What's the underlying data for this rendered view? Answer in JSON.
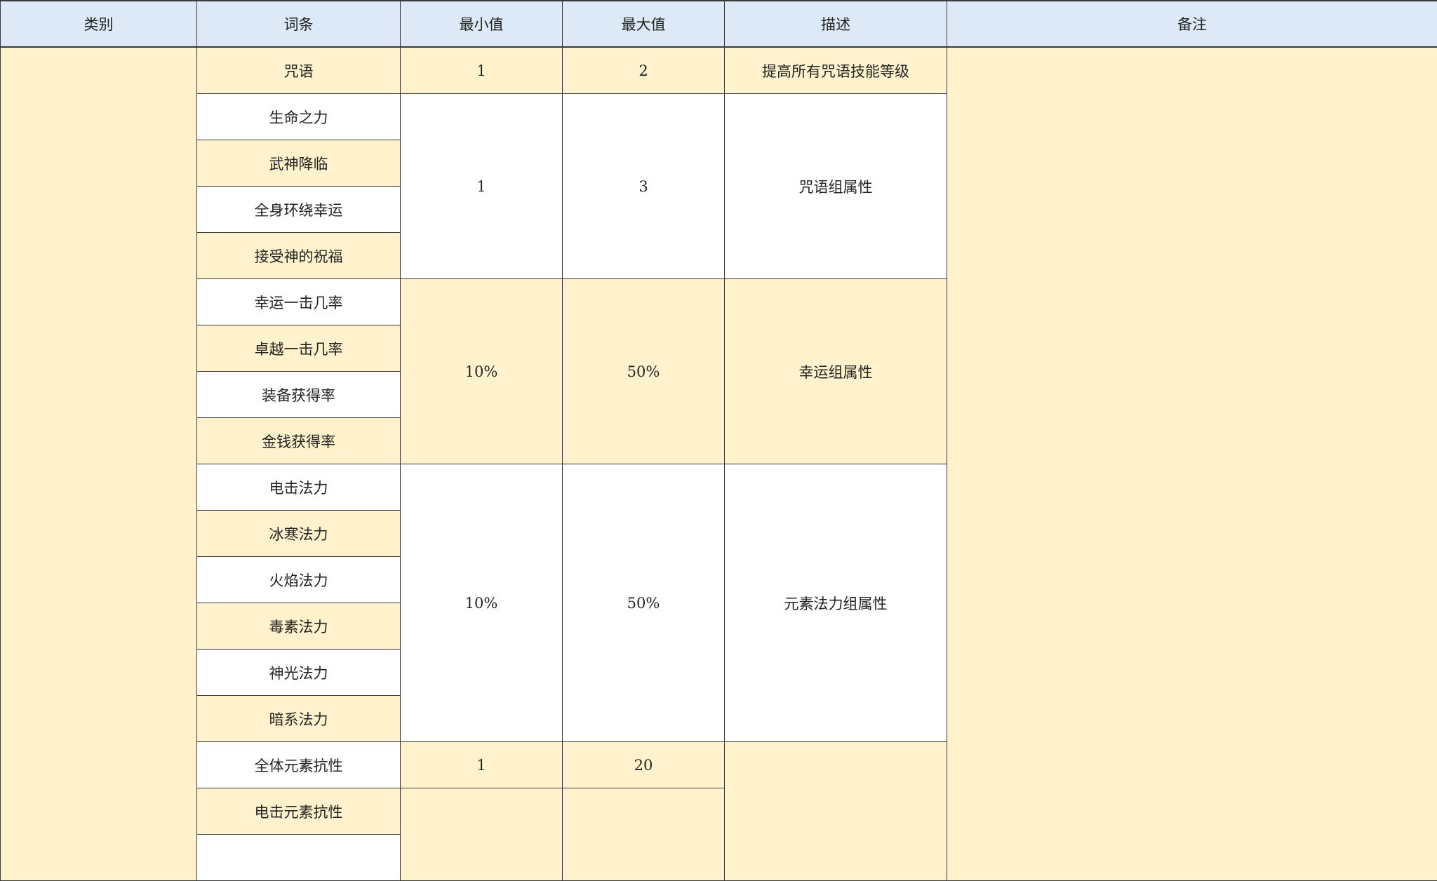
{
  "headers": {
    "category": "类别",
    "entry": "词条",
    "min": "最小值",
    "max": "最大值",
    "desc": "描述",
    "note": "备注"
  },
  "rows": {
    "r0": {
      "entry": "咒语",
      "min": "1",
      "max": "2",
      "desc": "提高所有咒语技能等级"
    },
    "g1": {
      "entries": [
        "生命之力",
        "武神降临",
        "全身环绕幸运",
        "接受神的祝福"
      ],
      "min": "1",
      "max": "3",
      "desc": "咒语组属性"
    },
    "g2": {
      "entries": [
        "幸运一击几率",
        "卓越一击几率",
        "装备获得率",
        "金钱获得率"
      ],
      "min": "10%",
      "max": "50%",
      "desc": "幸运组属性"
    },
    "g3": {
      "entries": [
        "电击法力",
        "冰寒法力",
        "火焰法力",
        "毒素法力",
        "神光法力",
        "暗系法力"
      ],
      "min": "10%",
      "max": "50%",
      "desc": "元素法力组属性"
    },
    "g4": {
      "entries": [
        "全体元素抗性",
        "电击元素抗性"
      ],
      "min": "1",
      "max": "20"
    }
  },
  "colors": {
    "header_bg": "#dde9f6",
    "yellow_bg": "#fff2cc",
    "white_bg": "#ffffff",
    "border": "#3a3a3a"
  }
}
